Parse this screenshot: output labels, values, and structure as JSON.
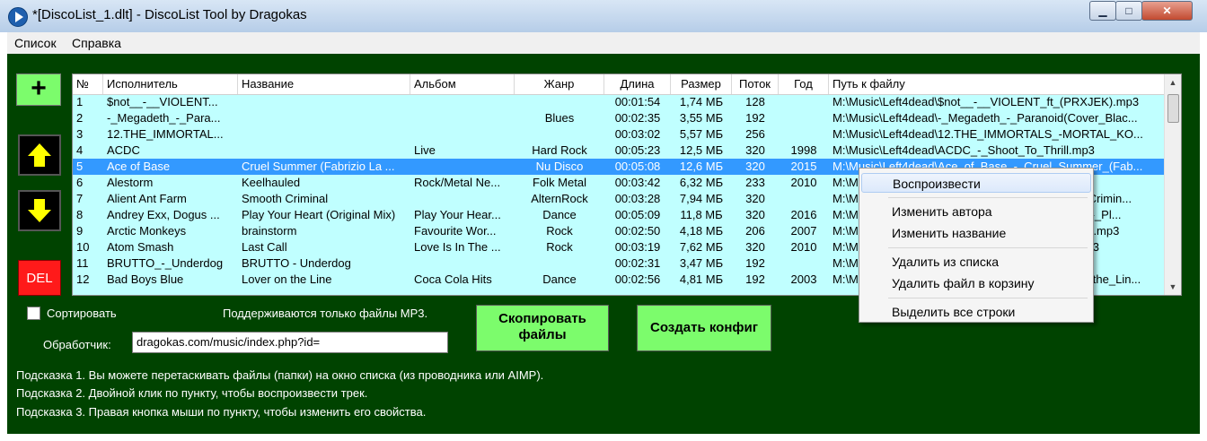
{
  "window": {
    "title": "*[DiscoList_1.dlt] - DiscoList Tool by Dragokas",
    "controls": {
      "minimize": "▁",
      "maximize": "□",
      "close": "✕"
    }
  },
  "menu": [
    "Список",
    "Справка"
  ],
  "side_buttons": {
    "add": "+",
    "up_icon": "arrow-up-icon",
    "down_icon": "arrow-down-icon",
    "del": "DEL"
  },
  "table": {
    "columns": [
      "№",
      "Исполнитель",
      "Название",
      "Альбом",
      "Жанр",
      "Длина",
      "Размер",
      "Поток",
      "Год",
      "Путь к файлу"
    ],
    "selected_row": 4,
    "rows": [
      [
        "1",
        "$not__-__VIOLENT...",
        "",
        "",
        "",
        "00:01:54",
        "1,74 МБ",
        "128",
        "",
        "M:\\Music\\Left4dead\\$not__-__VIOLENT_ft_(PRXJEK).mp3"
      ],
      [
        "2",
        "-_Megadeth_-_Para...",
        "",
        "",
        "Blues",
        "00:02:35",
        "3,55 МБ",
        "192",
        "",
        "M:\\Music\\Left4dead\\-_Megadeth_-_Paranoid(Cover_Blac..."
      ],
      [
        "3",
        "12.THE_IMMORTAL...",
        "",
        "",
        "",
        "00:03:02",
        "5,57 МБ",
        "256",
        "",
        "M:\\Music\\Left4dead\\12.THE_IMMORTALS_-MORTAL_KO..."
      ],
      [
        "4",
        "ACDC",
        "",
        "Live",
        "Hard Rock",
        "00:05:23",
        "12,5 МБ",
        "320",
        "1998",
        "M:\\Music\\Left4dead\\ACDC_-_Shoot_To_Thrill.mp3"
      ],
      [
        "5",
        "Ace of Base",
        "Cruel Summer (Fabrizio La ...",
        "",
        "Nu Disco",
        "00:05:08",
        "12,6 МБ",
        "320",
        "2015",
        "M:\\Music\\Left4dead\\Ace_of_Base_-_Cruel_Summer_(Fab..."
      ],
      [
        "6",
        "Alestorm",
        "Keelhauled",
        "Rock/Metal Ne...",
        "Folk Metal",
        "00:03:42",
        "6,32 МБ",
        "233",
        "2010",
        "M:\\Music\\Left4dead\\Alestorm_-_Keelhauled.mp3"
      ],
      [
        "7",
        "Alient Ant Farm",
        "Smooth Criminal",
        "",
        "AlternRock",
        "00:03:28",
        "7,94 МБ",
        "320",
        "",
        "M:\\Music\\Left4dead\\Alient_Ant_Farm_-_Smooth_Crimin..."
      ],
      [
        "8",
        "Andrey Exx, Dogus ...",
        "Play Your Heart (Original Mix)",
        "Play Your Hear...",
        "Dance",
        "00:05:09",
        "11,8 МБ",
        "320",
        "2016",
        "M:\\Music\\Left4dead\\Andrey_Exx_Dogus_Cakcor_-_Pl..."
      ],
      [
        "9",
        "Arctic Monkeys",
        "brainstorm",
        "Favourite Wor...",
        "Rock",
        "00:02:50",
        "4,18 МБ",
        "206",
        "2007",
        "M:\\Music\\Left4dead\\Arctic_Monkeys_-_Brainstorm.mp3"
      ],
      [
        "10",
        "Atom Smash",
        "Last Call",
        "Love Is In The ...",
        "Rock",
        "00:03:19",
        "7,62 МБ",
        "320",
        "2010",
        "M:\\Music\\Left4dead\\Atom_Smash_-_Last_Call.mp3"
      ],
      [
        "11",
        "BRUTTO_-_Underdog",
        "BRUTTO - Underdog",
        "",
        "",
        "00:02:31",
        "3,47 МБ",
        "192",
        "",
        "M:\\Music\\Left4dead\\BRUTTO_-_Underdog.mp3"
      ],
      [
        "12",
        "Bad Boys Blue",
        "Lover on the Line",
        "Coca Cola Hits",
        "Dance",
        "00:02:56",
        "4,81 МБ",
        "192",
        "2003",
        "M:\\Music\\Left4dead\\Bad_Boys_Blue_-_Lover_on_the_Lin..."
      ]
    ]
  },
  "options": {
    "sort_label": "Сортировать",
    "mp3_notice": "Поддерживаются только файлы MP3.",
    "handler_label": "Обработчик:",
    "handler_value": "dragokas.com/music/index.php?id="
  },
  "buttons": {
    "copy_line1": "Скопировать",
    "copy_line2": "файлы",
    "config": "Создать конфиг"
  },
  "hints": [
    "Подсказка 1. Вы можете перетаскивать файлы (папки) на окно списка (из проводника или AIMP).",
    "Подсказка 2. Двойной клик по пункту, чтобы воспроизвести трек.",
    "Подсказка 3. Правая кнопка мыши по пункту, чтобы изменить его свойства."
  ],
  "context_menu": {
    "play": "Воспроизвести",
    "edit_artist": "Изменить автора",
    "edit_title": "Изменить название",
    "remove_from_list": "Удалить из списка",
    "delete_to_trash": "Удалить файл в корзину",
    "select_all": "Выделить все строки"
  },
  "colors": {
    "background": "#004300",
    "list_bg": "#c0ffff",
    "selected": "#3399ff",
    "button_green": "#7cfc6c",
    "del_red": "#ff1a1a"
  }
}
